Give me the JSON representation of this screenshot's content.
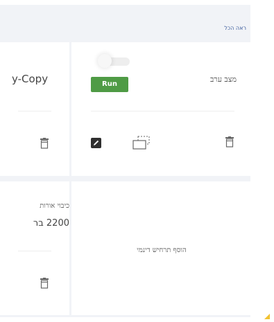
{
  "header": {
    "see_all_label": "ראה הכל"
  },
  "scene_card": {
    "name": "מצב ערב",
    "run_label": "Run",
    "toggle_enabled": false,
    "action_icons": [
      "edit-icon",
      "copy-icon",
      "trash-icon"
    ]
  },
  "left_card_top": {
    "title": "y-Copy",
    "action_icons": [
      "trash-icon"
    ]
  },
  "left_card_bottom": {
    "line1": "כיבוי אורות",
    "line2": "2200 בר",
    "action_icons": [
      "trash-icon"
    ]
  },
  "add_card": {
    "label": "הוסף תרחיש דינמי"
  },
  "colors": {
    "panel_bg": "#f1f3f7",
    "card_bg": "#ffffff",
    "run_button_bg": "#4f9b45",
    "link": "#3f5f9e",
    "corner_accent": "#f1c232"
  }
}
